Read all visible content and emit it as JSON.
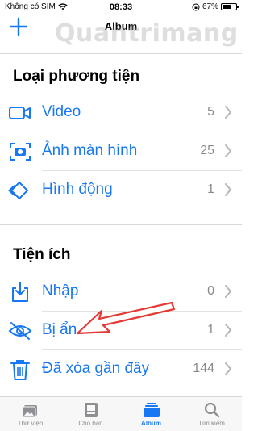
{
  "status_bar": {
    "carrier": "Không có SIM",
    "time": "08:33",
    "battery": "67%",
    "battery_level": 0.67
  },
  "nav": {
    "title": "Album",
    "add_icon": "plus-icon"
  },
  "watermark": "Quantrimang",
  "sections": [
    {
      "title": "Loại phương tiện",
      "items": [
        {
          "label": "Video",
          "count": "5",
          "icon": "video-icon"
        },
        {
          "label": "Ảnh màn hình",
          "count": "25",
          "icon": "screenshot-icon"
        },
        {
          "label": "Hình động",
          "count": "1",
          "icon": "animated-icon"
        }
      ]
    },
    {
      "title": "Tiện ích",
      "items": [
        {
          "label": "Nhập",
          "count": "0",
          "icon": "import-icon"
        },
        {
          "label": "Bị ẩn",
          "count": "1",
          "icon": "hidden-eye-icon"
        },
        {
          "label": "Đã xóa gần đây",
          "count": "144",
          "icon": "trash-icon"
        }
      ]
    }
  ],
  "tabs": [
    {
      "label": "Thư viện",
      "icon": "photo-library-icon",
      "active": false
    },
    {
      "label": "Cho bạn",
      "icon": "for-you-icon",
      "active": false
    },
    {
      "label": "Album",
      "icon": "album-icon",
      "active": true
    },
    {
      "label": "Tìm kiếm",
      "icon": "search-icon",
      "active": false
    }
  ],
  "colors": {
    "accent": "#1877f2",
    "annotation_arrow": "#e53935",
    "count_gray": "#8a8a8e"
  }
}
